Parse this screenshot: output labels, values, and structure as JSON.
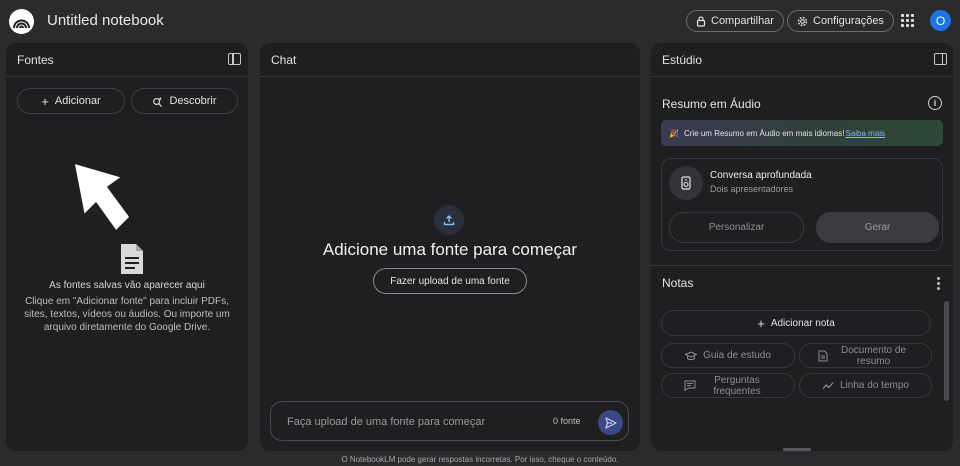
{
  "header": {
    "notebook_title": "Untitled notebook",
    "share_label": "Compartilhar",
    "settings_label": "Configurações",
    "avatar_letter": "O"
  },
  "sources": {
    "title": "Fontes",
    "add_label": "Adicionar",
    "discover_label": "Descobrir",
    "empty_heading": "As fontes salvas vão aparecer aqui",
    "empty_body": "Clique em \"Adicionar fonte\" para incluir PDFs, sites, textos, vídeos ou áudios. Ou importe um arquivo diretamente do Google Drive."
  },
  "chat": {
    "title": "Chat",
    "heading": "Adicione uma fonte para começar",
    "upload_label": "Fazer upload de uma fonte",
    "input_placeholder": "Faça upload de uma fonte para começar",
    "source_count": "0 fonte"
  },
  "studio": {
    "title": "Estúdio",
    "audio_title": "Resumo em Áudio",
    "banner_text": "Crie um Resumo em Áudio em mais idiomas!",
    "banner_link": "Saiba mais",
    "card_title": "Conversa aprofundada",
    "card_subtitle": "Dois apresentadores",
    "customize_label": "Personalizar",
    "generate_label": "Gerar",
    "notes_title": "Notas",
    "add_note_label": "Adicionar nota",
    "chips": [
      {
        "label": "Guia de estudo",
        "icon": "graduation-cap-icon"
      },
      {
        "label": "Documento de resumo",
        "icon": "document-icon"
      },
      {
        "label": "Perguntas frequentes",
        "icon": "chat-bubble-icon"
      },
      {
        "label": "Linha do tempo",
        "icon": "timeline-icon"
      }
    ]
  },
  "footer_text": "O NotebookLM pode gerar respostas incorretas. Por isso, cheque o conteúdo.",
  "colors": {
    "background": "#2b2b2e",
    "panel": "#1f1f22",
    "accent_avatar": "#1a73e8",
    "send_button": "#3b4a86",
    "link": "#8ab4f8"
  }
}
